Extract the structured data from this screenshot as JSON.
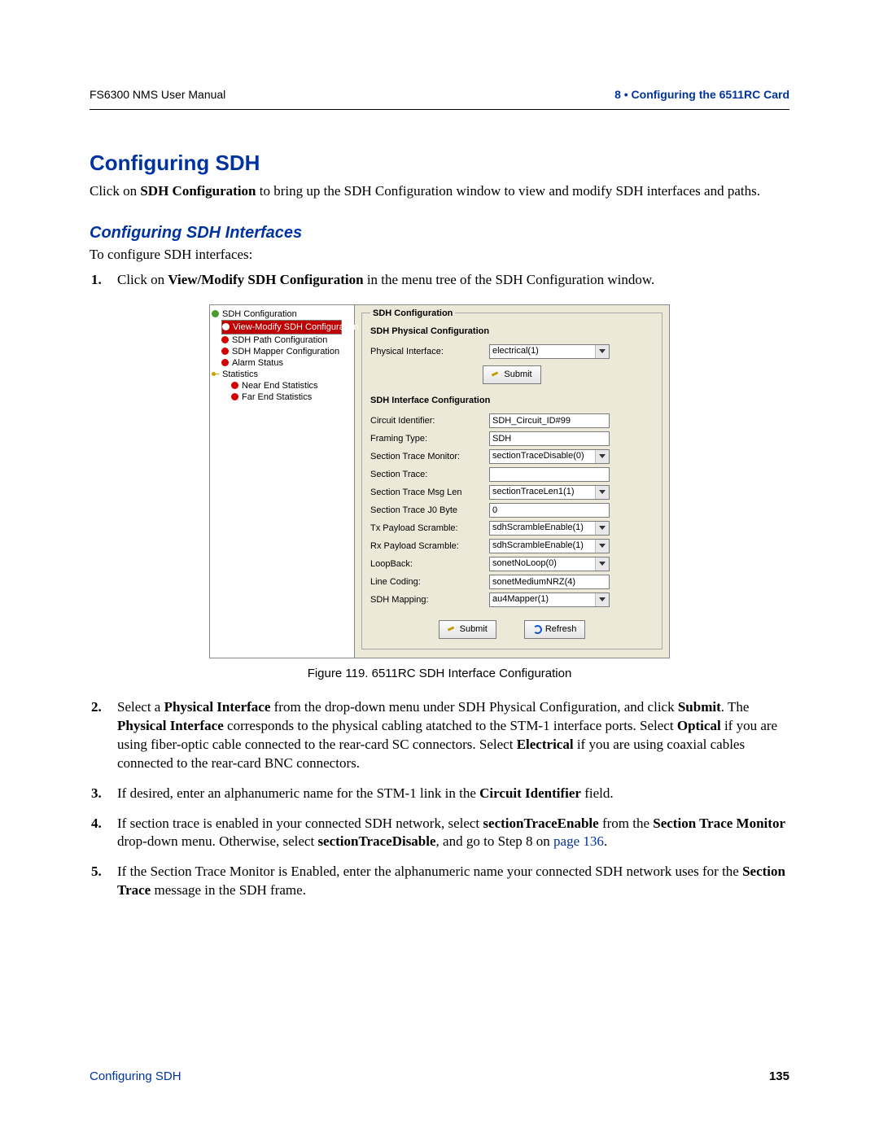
{
  "header": {
    "left": "FS6300 NMS User Manual",
    "right": "8 • Configuring the 6511RC Card"
  },
  "title": "Configuring SDH",
  "intro_parts": {
    "pre": "Click on ",
    "bold": "SDH Configuration",
    "post": " to bring up the SDH Configuration window to view and modify SDH interfaces and paths."
  },
  "sub_title": "Configuring SDH Interfaces",
  "sub_intro": "To configure SDH interfaces:",
  "step1": {
    "num": "1.",
    "pre": "Click on ",
    "bold": "View/Modify SDH Configuration",
    "post": " in the menu tree of the SDH Configuration window."
  },
  "tree": {
    "n0": "SDH Configuration",
    "n1": "View-Modify SDH Configuration",
    "n2": "SDH Path Configuration",
    "n3": "SDH Mapper Configuration",
    "n4": "Alarm Status",
    "n5": "Statistics",
    "n6": "Near End Statistics",
    "n7": "Far End Statistics"
  },
  "panel": {
    "legend": "SDH Configuration",
    "phys_title": "SDH Physical Configuration",
    "phys_label": "Physical Interface:",
    "phys_value": "electrical(1)",
    "submit": "Submit",
    "ifc_title": "SDH Interface Configuration",
    "rows": {
      "r0_label": "Circuit Identifier:",
      "r0_val": "SDH_Circuit_ID#99",
      "r1_label": "Framing Type:",
      "r1_val": "SDH",
      "r2_label": "Section Trace Monitor:",
      "r2_val": "sectionTraceDisable(0)",
      "r3_label": "Section Trace:",
      "r3_val": "",
      "r4_label": "Section Trace Msg Len",
      "r4_val": "sectionTraceLen1(1)",
      "r5_label": "Section Trace J0 Byte",
      "r5_val": "0",
      "r6_label": "Tx Payload Scramble:",
      "r6_val": "sdhScrambleEnable(1)",
      "r7_label": "Rx Payload Scramble:",
      "r7_val": "sdhScrambleEnable(1)",
      "r8_label": "LoopBack:",
      "r8_val": "sonetNoLoop(0)",
      "r9_label": "Line Coding:",
      "r9_val": "sonetMediumNRZ(4)",
      "r10_label": "SDH Mapping:",
      "r10_val": "au4Mapper(1)"
    },
    "refresh": "Refresh"
  },
  "caption": "Figure 119. 6511RC SDH Interface Configuration",
  "step2": {
    "num": "2.",
    "a1": "Select a ",
    "b1": "Physical Interface",
    "a2": " from the drop-down menu under SDH Physical Configuration, and click ",
    "b2": "Submit",
    "a3": ". The ",
    "b3": "Physical Interface",
    "a4": " corresponds to the physical cabling atatched to the STM-1 interface ports. Select ",
    "b4": "Optical",
    "a5": " if you are using fiber-optic cable connected to the rear-card SC connectors. Select ",
    "b5": "Electrical",
    "a6": " if you are using coaxial cables connected to the rear-card BNC connectors."
  },
  "step3": {
    "num": "3.",
    "a1": "If desired, enter an alphanumeric name for the STM-1 link in the ",
    "b1": "Circuit Identifier",
    "a2": " field."
  },
  "step4": {
    "num": "4.",
    "a1": "If section trace is enabled in your connected SDH network, select ",
    "b1": "sectionTraceEnable",
    "a2": " from the ",
    "b2": "Section Trace Monitor",
    "a3": " drop-down menu. Otherwise, select ",
    "b3": "sectionTraceDisable",
    "a4": ", and go to Step 8 on ",
    "link": "page 136",
    "a5": "."
  },
  "step5": {
    "num": "5.",
    "a1": "If the Section Trace Monitor is Enabled, enter the alphanumeric name your connected SDH network uses for the ",
    "b1": "Section Trace",
    "a2": " message in the SDH frame."
  },
  "footer": {
    "left": "Configuring SDH",
    "right": "135"
  }
}
